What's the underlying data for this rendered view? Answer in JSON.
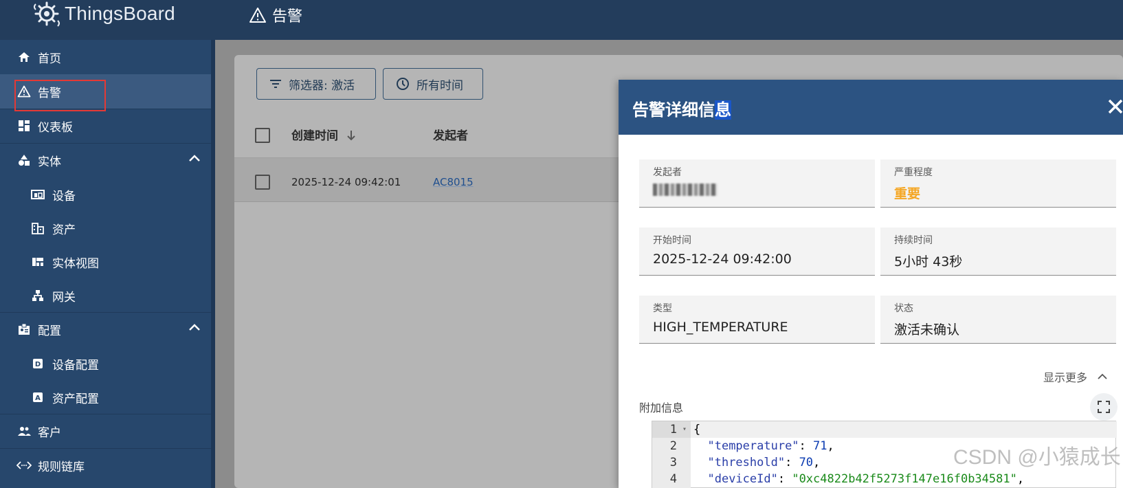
{
  "app": {
    "logo_text": "ThingsBoard",
    "page_title": "告警"
  },
  "sidebar": {
    "items": [
      {
        "label": "首页",
        "icon": "home-icon"
      },
      {
        "label": "告警",
        "icon": "warning-icon",
        "active": true
      },
      {
        "label": "仪表板",
        "icon": "dashboard-icon"
      },
      {
        "label": "实体",
        "icon": "entity-icon",
        "expanded": true
      },
      {
        "label": "设备",
        "icon": "device-icon",
        "sub": true
      },
      {
        "label": "资产",
        "icon": "asset-icon",
        "sub": true
      },
      {
        "label": "实体视图",
        "icon": "entity-view-icon",
        "sub": true
      },
      {
        "label": "网关",
        "icon": "gateway-icon",
        "sub": true
      },
      {
        "label": "配置",
        "icon": "profile-icon",
        "expanded": true
      },
      {
        "label": "设备配置",
        "icon": "device-profile-icon",
        "sub": true
      },
      {
        "label": "资产配置",
        "icon": "asset-profile-icon",
        "sub": true
      },
      {
        "label": "客户",
        "icon": "customers-icon"
      },
      {
        "label": "规则链库",
        "icon": "rule-chain-icon"
      }
    ]
  },
  "toolbar": {
    "filter_label": "筛选器: 激活",
    "time_label": "所有时间"
  },
  "table": {
    "columns": [
      "创建时间",
      "发起者"
    ],
    "rows": [
      {
        "created": "2025-12-24 09:42:01",
        "originator": "AC8015"
      }
    ]
  },
  "dialog": {
    "title": "告警详细信息",
    "title_selected_char": "息",
    "fields": {
      "originator_label": "发起者",
      "severity_label": "严重程度",
      "severity_value": "重要",
      "start_time_label": "开始时间",
      "start_time_value": "2025-12-24 09:42:00",
      "duration_label": "持续时间",
      "duration_value": "5小时 43秒",
      "type_label": "类型",
      "type_value": "HIGH_TEMPERATURE",
      "status_label": "状态",
      "status_value": "激活未确认"
    },
    "show_more": "显示更多",
    "extra_info_label": "附加信息",
    "code_lines": [
      {
        "num": "1",
        "text": "{"
      },
      {
        "num": "2",
        "key": "\"temperature\"",
        "value": "71",
        "value_type": "number"
      },
      {
        "num": "3",
        "key": "\"threshold\"",
        "value": "70",
        "value_type": "number"
      },
      {
        "num": "4",
        "key": "\"deviceId\"",
        "value": "\"0xc4822b42f5273f147e16f0b34581\"",
        "value_type": "string"
      }
    ]
  },
  "watermark": "CSDN @小猿成长",
  "colors": {
    "topbar": "#233d5c",
    "sidebar": "#27476c",
    "dialog_header": "#2c5382",
    "severity": "#f5a623",
    "highlight_box": "#e53935"
  }
}
